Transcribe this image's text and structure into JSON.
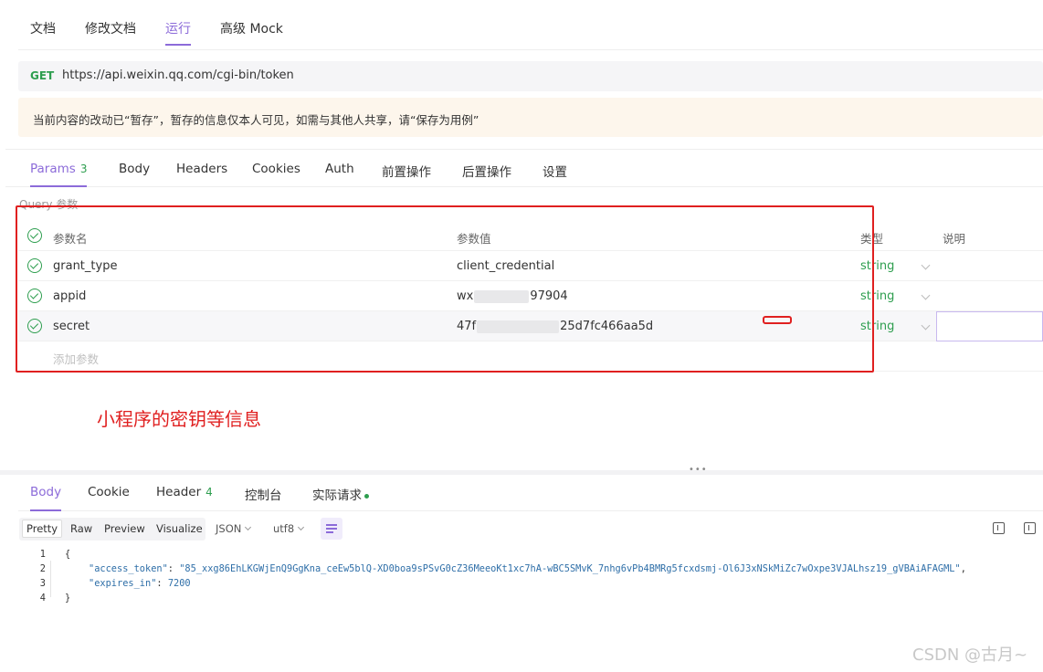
{
  "top_tabs": [
    {
      "label": "文档"
    },
    {
      "label": "修改文档"
    },
    {
      "label": "运行"
    },
    {
      "label": "高级 Mock"
    }
  ],
  "request": {
    "method": "GET",
    "url": "https://api.weixin.qq.com/cgi-bin/token"
  },
  "notice": "当前内容的改动已“暂存”，暂存的信息仅本人可见，如需与其他人共享，请“保存为用例”",
  "param_tabs": [
    {
      "label": "Params",
      "count": "3"
    },
    {
      "label": "Body"
    },
    {
      "label": "Headers"
    },
    {
      "label": "Cookies"
    },
    {
      "label": "Auth"
    },
    {
      "label": "前置操作"
    },
    {
      "label": "后置操作"
    },
    {
      "label": "设置"
    }
  ],
  "query_label": "Query 参数",
  "table": {
    "headers": {
      "name": "参数名",
      "value": "参数值",
      "type": "类型",
      "desc": "说明"
    },
    "rows": [
      {
        "name": "grant_type",
        "value": "client_credential",
        "type": "string"
      },
      {
        "name": "appid",
        "value_prefix": "wx",
        "value_suffix": "97904",
        "type": "string"
      },
      {
        "name": "secret",
        "value_prefix": "47f",
        "value_suffix": "25d7fc466aa5d",
        "type": "string"
      }
    ],
    "add_param": "添加参数"
  },
  "annotation": "小程序的密钥等信息",
  "response_tabs": [
    {
      "label": "Body"
    },
    {
      "label": "Cookie"
    },
    {
      "label": "Header",
      "count": "4"
    },
    {
      "label": "控制台"
    },
    {
      "label": "实际请求"
    }
  ],
  "view_modes": [
    "Pretty",
    "Raw",
    "Preview",
    "Visualize"
  ],
  "format_select": "JSON",
  "encoding_select": "utf8",
  "code": {
    "line_numbers": [
      "1",
      "2",
      "3",
      "4"
    ],
    "open_brace": "{",
    "close_brace": "}",
    "key1": "\"access_token\"",
    "val1": "\"85_xxg86EhLKGWjEnQ9GgKna_ceEw5blQ-XD0boa9sPSvG0cZ36MeeoKt1xc7hA-wBC5SMvK_7nhg6vPb4BMRg5fcxdsmj-Ol6J3xNSkMiZc7wOxpe3VJALhsz19_gVBAiAFAGML\"",
    "key2": "\"expires_in\"",
    "val2": "7200"
  },
  "watermark": "CSDN @古月~",
  "colors": {
    "accent": "#8c6bd9",
    "success": "#2e9e4f",
    "annotation": "#e02020"
  }
}
